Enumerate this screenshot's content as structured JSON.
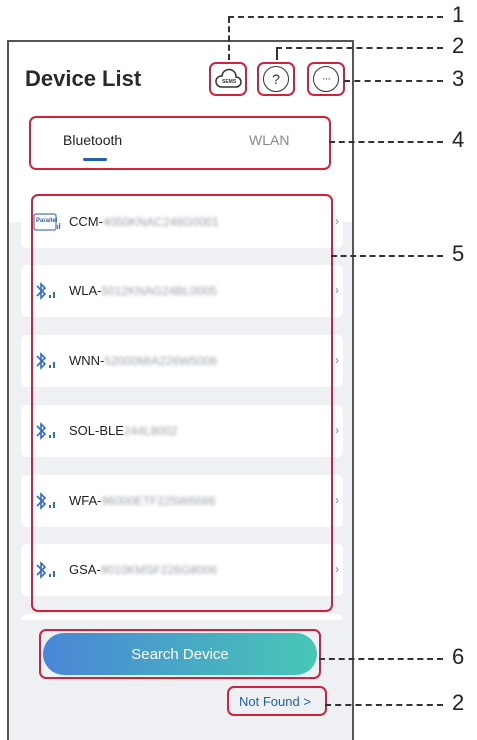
{
  "header": {
    "title": "Device List"
  },
  "icons": {
    "sems": "SEMS",
    "help": "?",
    "more": "···"
  },
  "tabs": [
    {
      "label": "Bluetooth"
    },
    {
      "label": "WLAN"
    }
  ],
  "devices": [
    {
      "prefix": "CCM-",
      "hidden": "4050KNAC248G0001"
    },
    {
      "prefix": "WLA-",
      "hidden": "5012KNAG24BL0005"
    },
    {
      "prefix": "WNN-",
      "hidden": "52000MIA226W5006"
    },
    {
      "prefix": "SOL-BLE",
      "hidden": "244L8002"
    },
    {
      "prefix": "WFA-",
      "hidden": "96000ETF225W6666"
    },
    {
      "prefix": "GSA-",
      "hidden": "9010KMSF226G8006"
    }
  ],
  "parallel_badge": "Parallel",
  "actions": {
    "search": "Search Device",
    "not_found": "Not Found >"
  },
  "callouts": [
    "1",
    "2",
    "3",
    "4",
    "5",
    "6",
    "2"
  ],
  "colors": {
    "accent": "#1f5fb5",
    "highlight": "#d2223b"
  }
}
